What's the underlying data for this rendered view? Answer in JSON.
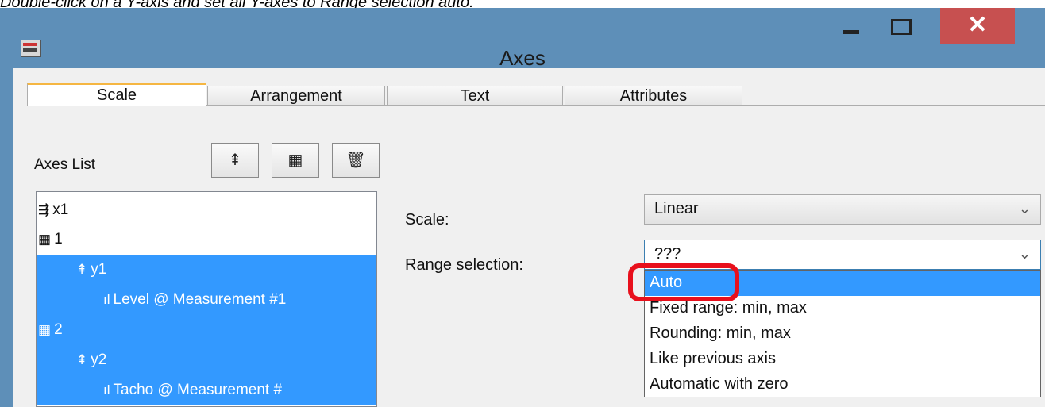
{
  "instruction": "Double-click on a Y-axis and set all Y-axes to Range selection auto.",
  "window": {
    "title": "Axes",
    "minimize_icon": "minimize-icon",
    "maximize_icon": "maximize-icon",
    "close_symbol": "✕"
  },
  "tabs": [
    {
      "label": "Scale",
      "active": true
    },
    {
      "label": "Arrangement",
      "active": false
    },
    {
      "label": "Text",
      "active": false
    },
    {
      "label": "Attributes",
      "active": false
    }
  ],
  "axes_list": {
    "label": "Axes List",
    "toolbar": [
      "add-y-axis-icon",
      "add-system-icon",
      "delete-icon"
    ],
    "items": [
      {
        "text": "x1",
        "icon": "x-axis-icon",
        "selected": false
      },
      {
        "text": "1",
        "icon": "system-icon",
        "selected": false
      },
      {
        "text": "y1",
        "icon": "y-axis-icon",
        "selected": true
      },
      {
        "text": "Level @ Measurement #1",
        "icon": "channel-icon",
        "selected": true
      },
      {
        "text": "2",
        "icon": "system-icon",
        "selected": true
      },
      {
        "text": "y2",
        "icon": "y-axis-icon",
        "selected": true
      },
      {
        "text": "Tacho @ Measurement #",
        "icon": "channel-icon",
        "selected": true
      }
    ]
  },
  "scale": {
    "label": "Scale:",
    "value": "Linear"
  },
  "range_selection": {
    "label": "Range selection:",
    "value": "???",
    "options": [
      {
        "label": "Auto",
        "highlighted": true
      },
      {
        "label": "Fixed range: min, max",
        "highlighted": false
      },
      {
        "label": "Rounding: min, max",
        "highlighted": false
      },
      {
        "label": "Like previous axis",
        "highlighted": false
      },
      {
        "label": "Automatic with zero",
        "highlighted": false
      },
      {
        "label": "???",
        "highlighted": false
      }
    ]
  },
  "colors": {
    "title_bar": "#5e8fb8",
    "close_button": "#c75050",
    "selection": "#3399ff",
    "annotation_ring": "#e8101c",
    "active_tab_accent": "#f5b642"
  }
}
